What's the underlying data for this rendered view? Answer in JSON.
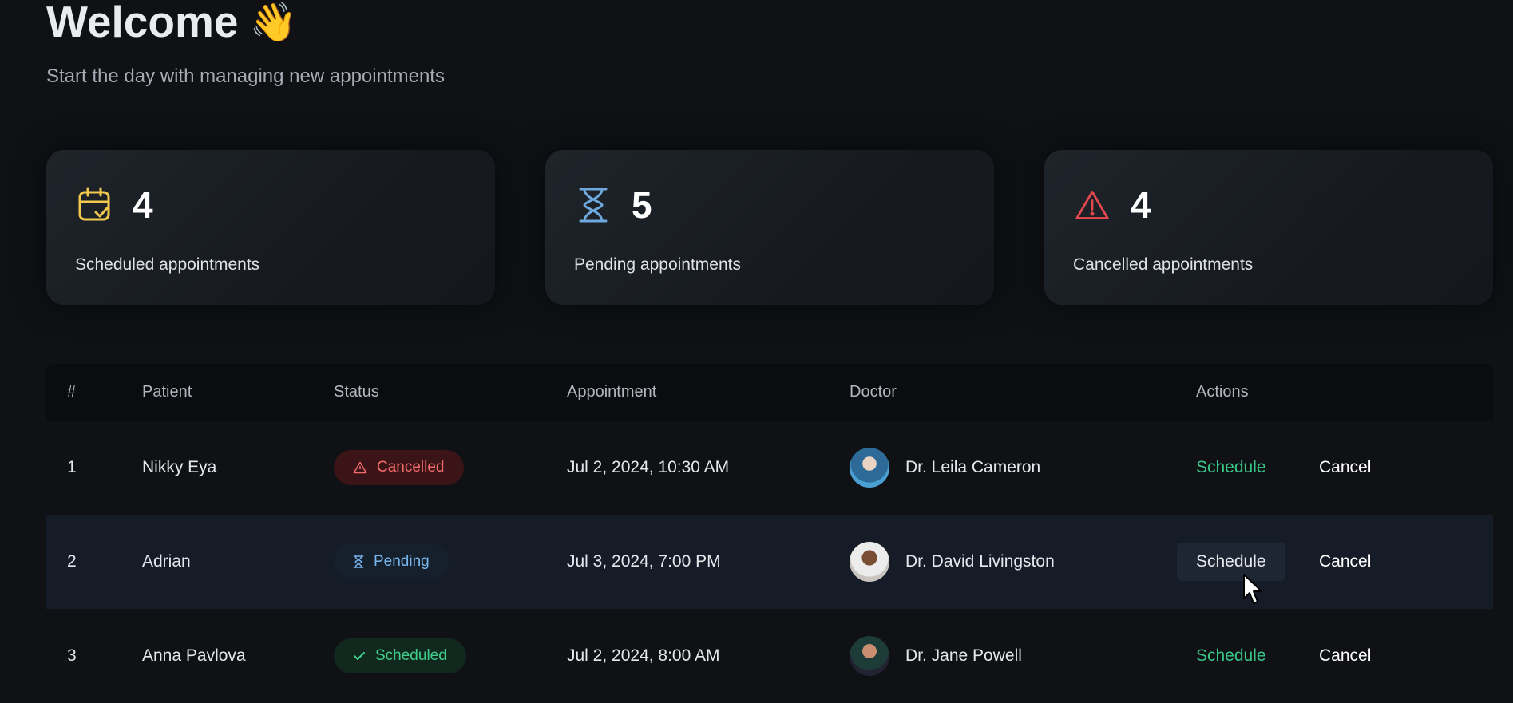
{
  "header": {
    "title": "Welcome",
    "wave_icon": "waving-hand-emoji",
    "subtitle": "Start the day with managing new appointments"
  },
  "stats": [
    {
      "icon": "calendar-check-icon",
      "color": "#f2c94c",
      "count": "4",
      "label": "Scheduled appointments"
    },
    {
      "icon": "hourglass-icon",
      "color": "#6fa8dc",
      "count": "5",
      "label": "Pending appointments"
    },
    {
      "icon": "warning-triangle-icon",
      "color": "#e5484d",
      "count": "4",
      "label": "Cancelled appointments"
    }
  ],
  "table": {
    "headers": {
      "num": "#",
      "patient": "Patient",
      "status": "Status",
      "appointment": "Appointment",
      "doctor": "Doctor",
      "actions": "Actions"
    },
    "rows": [
      {
        "num": "1",
        "patient": "Nikky Eya",
        "status": "Cancelled",
        "appointment": "Jul 2, 2024, 10:30 AM",
        "doctor": "Dr. Leila Cameron",
        "schedule": "Schedule",
        "cancel": "Cancel"
      },
      {
        "num": "2",
        "patient": "Adrian",
        "status": "Pending",
        "appointment": "Jul 3, 2024, 7:00 PM",
        "doctor": "Dr. David Livingston",
        "schedule": "Schedule",
        "cancel": "Cancel"
      },
      {
        "num": "3",
        "patient": "Anna Pavlova",
        "status": "Scheduled",
        "appointment": "Jul 2, 2024, 8:00 AM",
        "doctor": "Dr. Jane Powell",
        "schedule": "Schedule",
        "cancel": "Cancel"
      }
    ]
  },
  "colors": {
    "background": "#0f1115",
    "accent_green": "#38c586",
    "cancelled": "#f56b6b",
    "pending": "#79b6ee",
    "scheduled": "#3fce8b"
  }
}
